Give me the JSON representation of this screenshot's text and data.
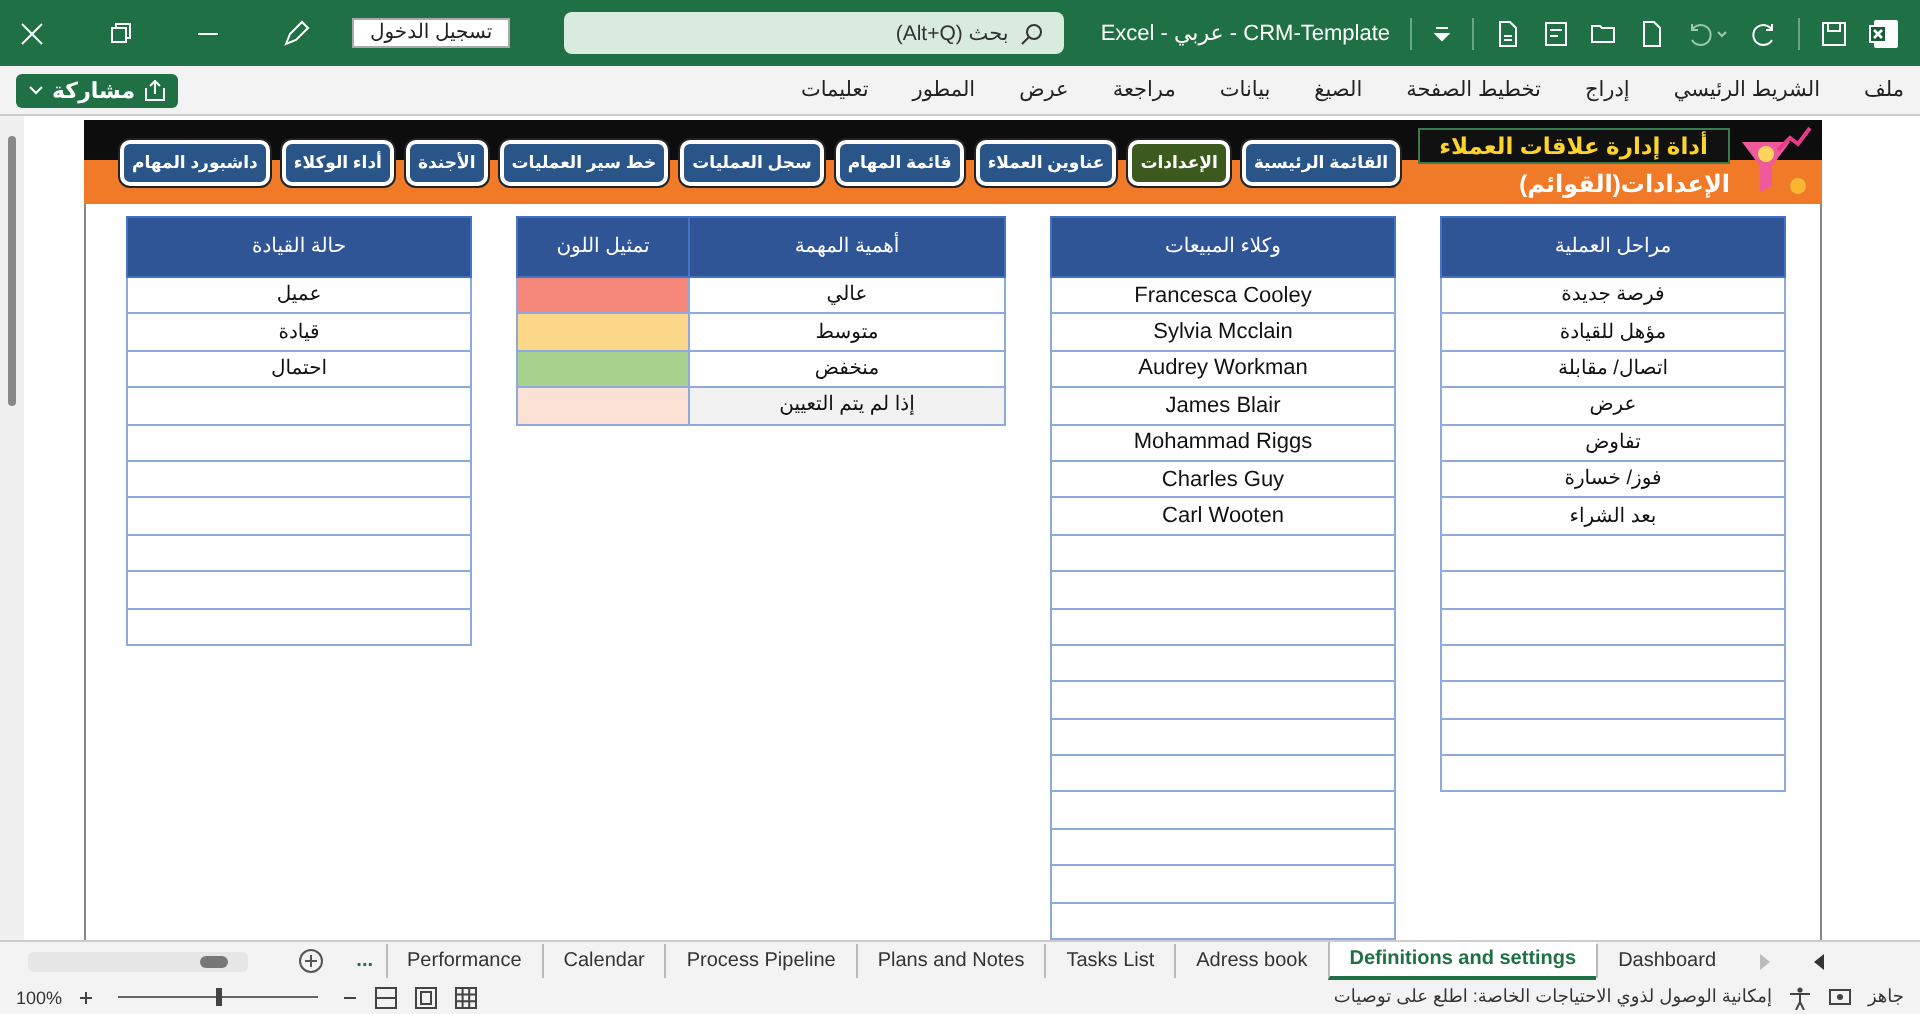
{
  "window": {
    "title": "CRM-Template - عربي - Excel",
    "search_placeholder": "بحث (Alt+Q)",
    "sign_in": "تسجيل الدخول"
  },
  "menu": [
    "ملف",
    "الشريط الرئيسي",
    "إدراج",
    "تخطيط الصفحة",
    "الصيغ",
    "بيانات",
    "مراجعة",
    "عرض",
    "المطور",
    "تعليمات"
  ],
  "share": "مشاركة",
  "banner": {
    "title": "أداة إدارة علاقات العملاء",
    "subtitle": "الإعدادات(القوائم)",
    "nav": [
      {
        "label": "القائمة الرئيسية",
        "selected": false
      },
      {
        "label": "الإعدادات",
        "selected": true
      },
      {
        "label": "عناوين العملاء",
        "selected": false
      },
      {
        "label": "قائمة المهام",
        "selected": false
      },
      {
        "label": "سجل العمليات",
        "selected": false
      },
      {
        "label": "خط سير العمليات",
        "selected": false
      },
      {
        "label": "الأجندة",
        "selected": false
      },
      {
        "label": "أداء الوكلاء",
        "selected": false
      },
      {
        "label": "داشبورد المهام",
        "selected": false
      }
    ]
  },
  "process_stages": {
    "heading": "مراحل العملية",
    "rows": [
      "فرصة جديدة",
      "مؤهل للقيادة",
      "اتصال/ مقابلة",
      "عرض",
      "تفاوض",
      "فوز/ خسارة",
      "بعد الشراء"
    ]
  },
  "sales_agents": {
    "heading": "وكلاء المبيعات",
    "rows": [
      "Francesca Cooley",
      "Sylvia Mcclain",
      "Audrey Workman",
      "James Blair",
      "Mohammad Riggs",
      "Charles Guy",
      "Carl Wooten"
    ]
  },
  "task_importance": {
    "heading": "أهمية المهمة",
    "color_heading": "تمثيل اللون",
    "rows": [
      {
        "label": "عالي",
        "color": "#f4877a",
        "kind": "level"
      },
      {
        "label": "متوسط",
        "color": "#fdd88a",
        "kind": "level"
      },
      {
        "label": "منخفض",
        "color": "#a9d18e",
        "kind": "level"
      },
      {
        "label": "إذا لم يتم التعيين",
        "color": "#fbe2d5",
        "kind": "unassigned"
      }
    ]
  },
  "lead_status": {
    "heading": "حالة القيادة",
    "rows": [
      "عميل",
      "قيادة",
      "احتمال"
    ]
  },
  "sheet_tabs": [
    {
      "label": "Dashboard",
      "selected": false
    },
    {
      "label": "Definitions and settings",
      "selected": true
    },
    {
      "label": "Adress book",
      "selected": false
    },
    {
      "label": "Tasks List",
      "selected": false
    },
    {
      "label": "Plans and Notes",
      "selected": false
    },
    {
      "label": "Process Pipeline",
      "selected": false
    },
    {
      "label": "Calendar",
      "selected": false
    },
    {
      "label": "Performance",
      "selected": false
    }
  ],
  "more_tabs": "...",
  "status_bar": {
    "ready": "جاهز",
    "accessibility": "إمكانية الوصول لذوي الاحتياجات الخاصة: اطلع على توصيات",
    "zoom": "100%",
    "zoom_slider": {
      "level": 0.5
    }
  }
}
